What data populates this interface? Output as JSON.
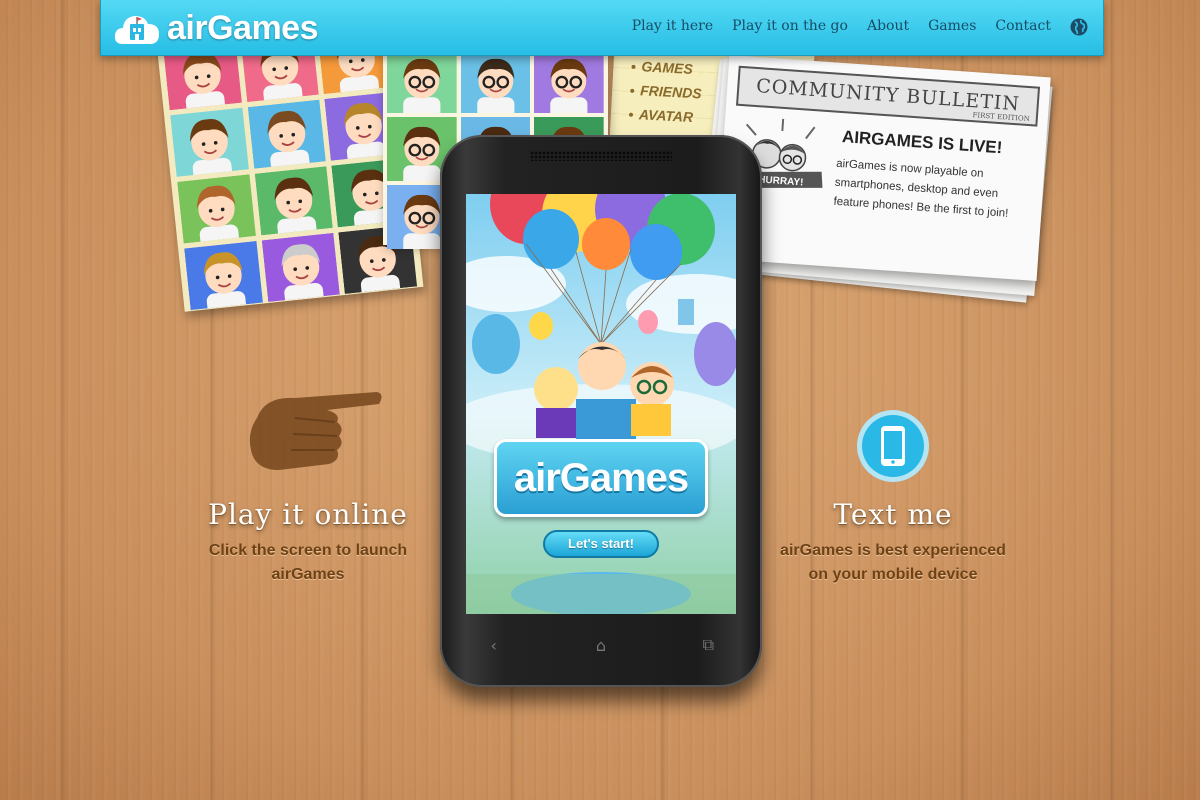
{
  "header": {
    "logo_text": "airGames",
    "nav": [
      "Play it here",
      "Play it on the go",
      "About",
      "Games",
      "Contact"
    ],
    "language_icon": "globe-icon",
    "bg_color": "#2ec4ec"
  },
  "menu_paper": {
    "items": [
      "GAMES",
      "FRIENDS",
      "AVATAR"
    ]
  },
  "bulletin": {
    "header": "COMMUNITY BULLETIN",
    "edition": "FIRST EDITION",
    "banner": "HURRAY!",
    "headline": "AIRGAMES IS LIVE!",
    "body": "airGames is now playable on smartphones, desktop and even feature phones! Be the first to join!"
  },
  "phone": {
    "app_name": "airGames",
    "start_button": "Let's start!",
    "nav_icons": [
      "back-icon",
      "home-icon",
      "recent-apps-icon"
    ]
  },
  "left": {
    "title": "Play it online",
    "desc_line1": "Click the screen to launch",
    "desc_line2": "airGames",
    "icon": "pointing-hand-icon"
  },
  "right": {
    "title": "Text me",
    "desc_line1": "airGames is best experienced",
    "desc_line2": "on your mobile device",
    "icon": "smartphone-icon"
  }
}
